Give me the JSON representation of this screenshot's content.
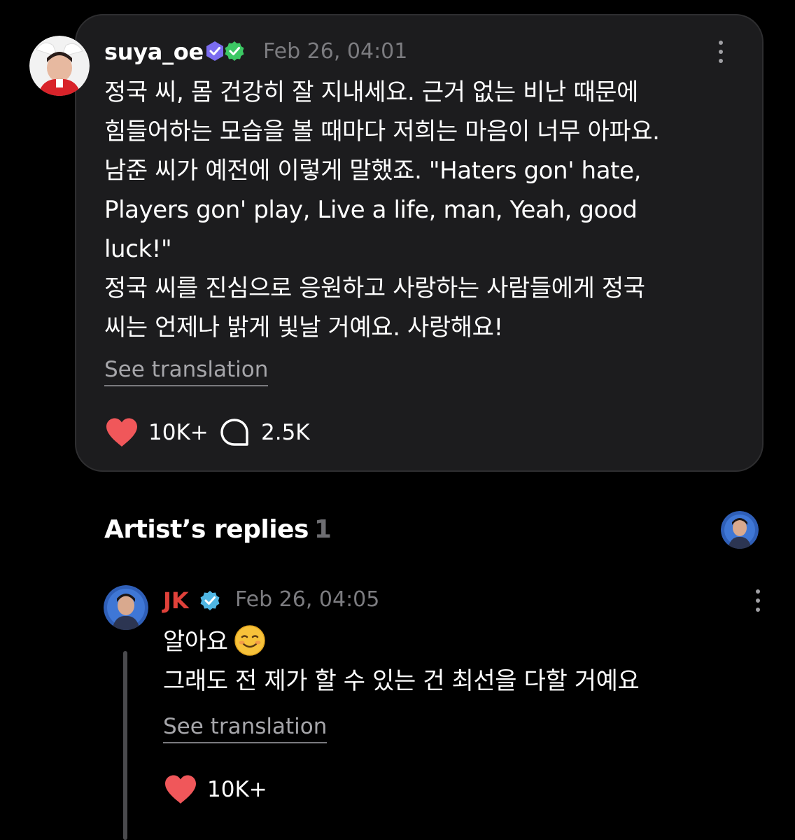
{
  "post": {
    "username": "suya_oe",
    "badges": [
      "membership-badge-icon",
      "verified-green-badge-icon"
    ],
    "timestamp": "Feb 26, 04:01",
    "text_lines": [
      "정국 씨, 몸 건강히 잘 지내세요. 근거 없는 비난 때문에",
      "힘들어하는 모습을 볼 때마다 저희는 마음이 너무 아파요.",
      "남준 씨가 예전에 이렇게 말했죠. \"Haters gon' hate,",
      "Players gon' play, Live a life, man, Yeah, good",
      "luck!\"",
      "정국 씨를 진심으로 응원하고 사랑하는 사람들에게 정국",
      "씨는 언제나 밝게 빛날 거예요. 사랑해요!"
    ],
    "see_translation": "See translation",
    "likes": "10K+",
    "comments": "2.5K"
  },
  "artist_replies": {
    "title": "Artist’s replies",
    "count": "1"
  },
  "reply": {
    "username": "JK",
    "timestamp": "Feb 26, 04:05",
    "text_lines": [
      "알아요",
      "그래도 전 제가 할 수 있는 건 최선을 다할 거예요"
    ],
    "emoji": "smiling-face-icon",
    "see_translation": "See translation",
    "likes": "10K+"
  },
  "colors": {
    "background": "#000000",
    "card": "#1c1c1e",
    "heart": "#f0575a",
    "artist_name": "#e0413a",
    "verified": "#4fb6e3",
    "muted_text": "#7c7c80"
  }
}
